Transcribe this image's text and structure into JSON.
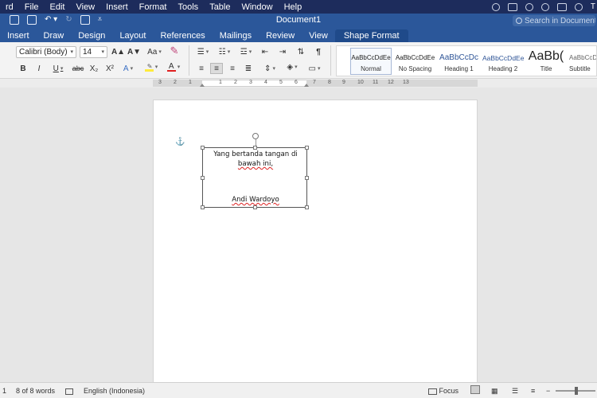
{
  "menubar": {
    "app": "rd",
    "items": [
      "File",
      "Edit",
      "View",
      "Insert",
      "Format",
      "Tools",
      "Table",
      "Window",
      "Help"
    ],
    "right_trailing": "T"
  },
  "titlebar": {
    "title": "Document1",
    "search_placeholder": "Search in Document"
  },
  "tabs": [
    "Insert",
    "Draw",
    "Design",
    "Layout",
    "References",
    "Mailings",
    "Review",
    "View",
    "Shape Format"
  ],
  "ribbon": {
    "font_name": "Calibri (Body)",
    "font_size": "14",
    "font_buttons": {
      "grow": "A▲",
      "shrink": "A▼",
      "change_case": "Aa",
      "bold": "B",
      "italic": "I",
      "underline": "U",
      "strikethrough": "abc",
      "subscript": "X₂",
      "superscript": "X²",
      "text_effects": "A",
      "font_color": "A"
    },
    "colors": {
      "highlight": "#ffeb3b",
      "font_color": "#e02020"
    },
    "styles": [
      {
        "sample": "AaBbCcDdEe",
        "name": "Normal"
      },
      {
        "sample": "AaBbCcDdEe",
        "name": "No Spacing"
      },
      {
        "sample": "AaBbCcDc",
        "name": "Heading 1"
      },
      {
        "sample": "AaBbCcDdEe",
        "name": "Heading 2"
      },
      {
        "sample": "AaBb(",
        "name": "Title"
      },
      {
        "sample": "AaBbCcDc",
        "name": "Subtitle"
      }
    ]
  },
  "ruler": {
    "numbers": [
      "3",
      "2",
      "1",
      "1",
      "2",
      "3",
      "4",
      "5",
      "6",
      "7",
      "8",
      "9",
      "10",
      "11",
      "12",
      "13"
    ]
  },
  "textbox": {
    "line1": "Yang bertanda tangan di",
    "line2": "bawah ini,",
    "signature": "Andi Wardoyo"
  },
  "status": {
    "page": "1",
    "words": "8 of 8 words",
    "language": "English (Indonesia)",
    "focus": "Focus"
  }
}
